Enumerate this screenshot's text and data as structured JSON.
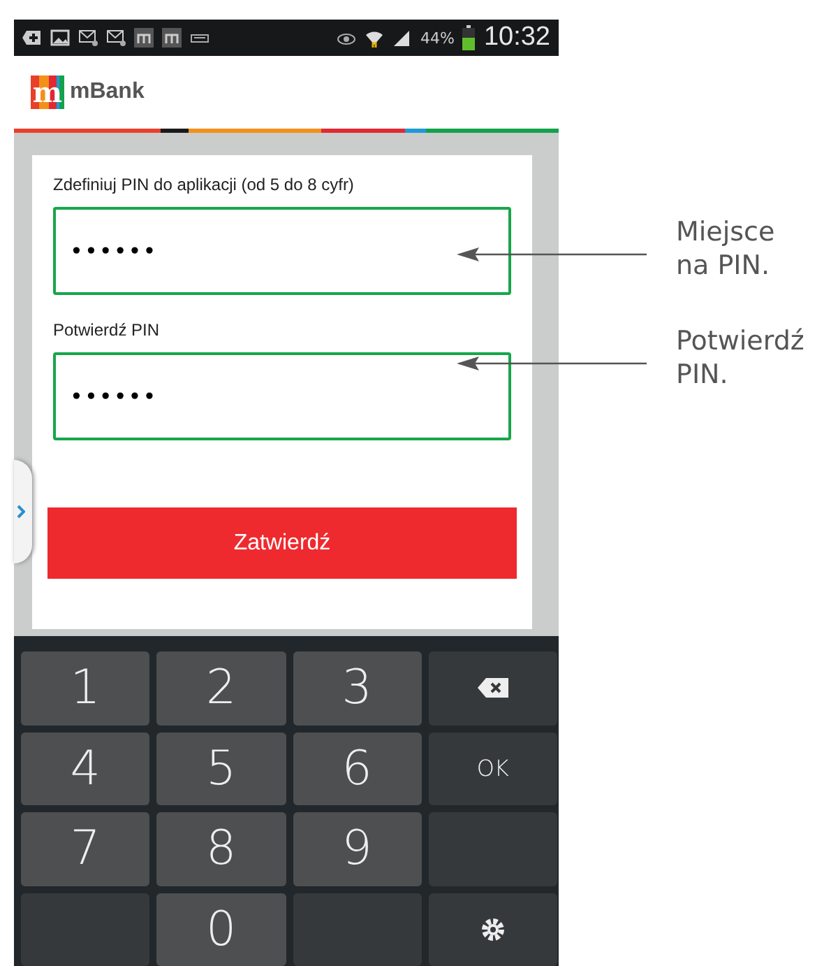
{
  "status_bar": {
    "battery": "44%",
    "time": "10:32"
  },
  "app_bar": {
    "logo_letter": "m",
    "title": "mBank"
  },
  "form": {
    "fields": [
      {
        "label": "Zdefiniuj PIN do aplikacji (od 5 do 8 cyfr)",
        "value": "••••••"
      },
      {
        "label": "Potwierdź PIN",
        "value": "••••••"
      }
    ],
    "submit": "Zatwierdź"
  },
  "keyboard": {
    "keys": [
      {
        "kind": "digit",
        "label": "1"
      },
      {
        "kind": "digit",
        "label": "2"
      },
      {
        "kind": "digit",
        "label": "3"
      },
      {
        "kind": "backspace"
      },
      {
        "kind": "digit",
        "label": "4"
      },
      {
        "kind": "digit",
        "label": "5"
      },
      {
        "kind": "digit",
        "label": "6"
      },
      {
        "kind": "ok",
        "label": "OK"
      },
      {
        "kind": "digit",
        "label": "7"
      },
      {
        "kind": "digit",
        "label": "8"
      },
      {
        "kind": "digit",
        "label": "9"
      },
      {
        "kind": "blank"
      },
      {
        "kind": "blank"
      },
      {
        "kind": "digit",
        "label": "0"
      },
      {
        "kind": "blank"
      },
      {
        "kind": "settings"
      }
    ]
  },
  "callouts": [
    {
      "text": "Miejsce\nna PIN."
    },
    {
      "text": "Potwierdź\nPIN."
    }
  ]
}
